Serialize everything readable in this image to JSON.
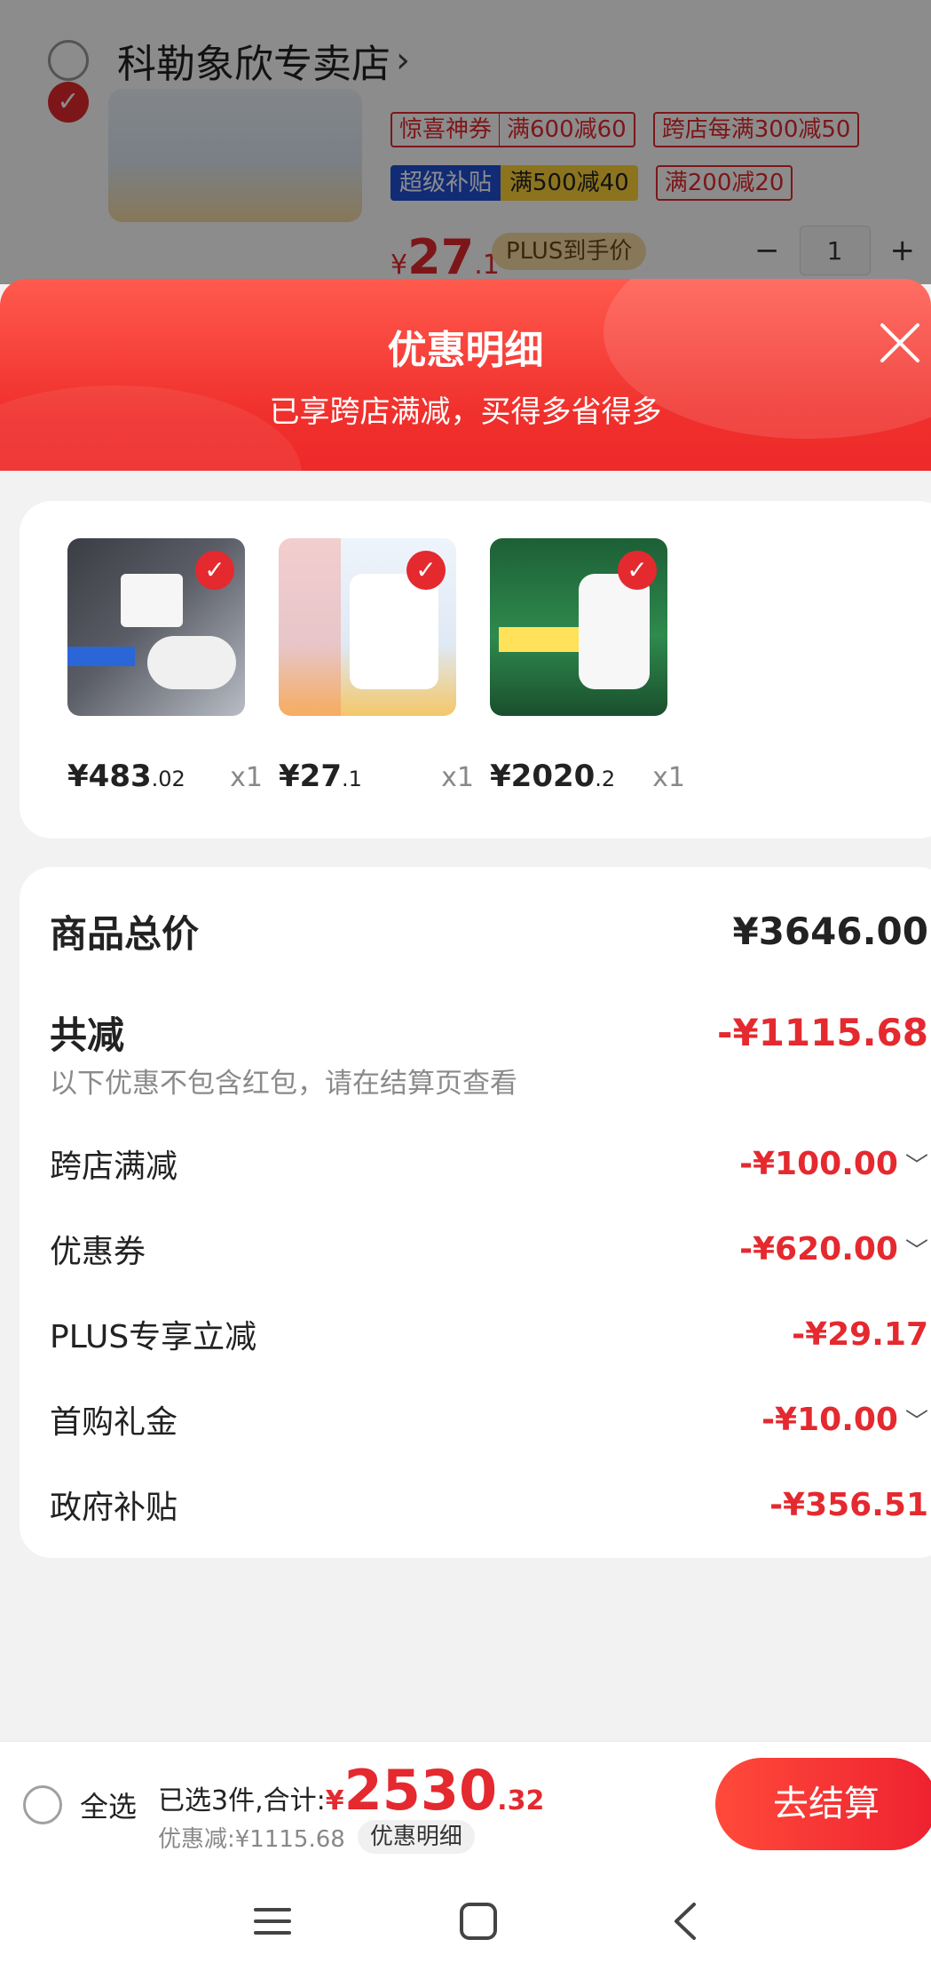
{
  "background_cart": {
    "shop_name": "科勒象欣专卖店",
    "shop_arrow": "›",
    "tags": [
      {
        "a": "惊喜神券",
        "b": "满600减60"
      },
      {
        "a": "跨店每满300减50"
      }
    ],
    "super_tag": {
      "a": "超级补贴",
      "b": "满500减40"
    },
    "extra_tag": "满200减20",
    "price_currency": "¥",
    "price_int": "27",
    "price_dec": ".1",
    "plus_label": "PLUS到手价",
    "qty_minus": "−",
    "qty": "1",
    "qty_plus": "+"
  },
  "sheet": {
    "title": "优惠明细",
    "subtitle": "已享跨店满减，买得多省得多"
  },
  "products": [
    {
      "price_int": "¥483",
      "price_dec": ".02",
      "qty": "x1"
    },
    {
      "price_int": "¥27",
      "price_dec": ".1",
      "qty": "x1"
    },
    {
      "price_int": "¥2020",
      "price_dec": ".2",
      "qty": "x1"
    }
  ],
  "details": {
    "total_label": "商品总价",
    "total_value": "¥3646.00",
    "reduced_label": "共减",
    "reduced_value": "-¥1115.68",
    "note": "以下优惠不包含红包，请在结算页查看",
    "items": [
      {
        "label": "跨店满减",
        "value": "-¥100.00",
        "chevron": true
      },
      {
        "label": "优惠券",
        "value": "-¥620.00",
        "chevron": true
      },
      {
        "label": "PLUS专享立减",
        "value": "-¥29.17",
        "chevron": false
      },
      {
        "label": "首购礼金",
        "value": "-¥10.00",
        "chevron": true
      },
      {
        "label": "政府补贴",
        "value": "-¥356.51",
        "chevron": false
      }
    ]
  },
  "bottom_bar": {
    "select_all": "全选",
    "selected_prefix": "已选3件,合计:",
    "currency": "¥",
    "total_int": "2530",
    "total_dec": ".32",
    "saved_text": "优惠减:¥1115.68",
    "detail_chip": "优惠明细",
    "checkout": "去结算"
  },
  "colors": {
    "accent": "#e4292f",
    "header_top": "#ff5a4e",
    "header_bottom": "#ee2a2a"
  }
}
